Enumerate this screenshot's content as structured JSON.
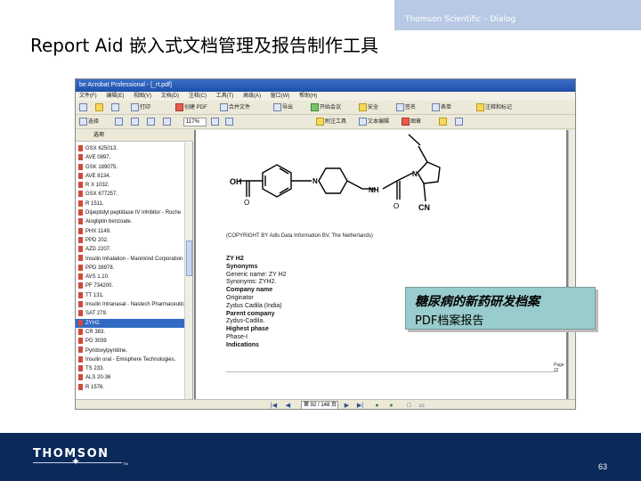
{
  "header": {
    "company": "Thomson Scientific – Dialog",
    "title": "Report Aid 嵌入式文档管理及报告制作工具"
  },
  "acrobat": {
    "window_title": "be Acrobat Professional - [_rt.pdf]",
    "menu": [
      "文件(F)",
      "编辑(E)",
      "视图(V)",
      "文档(D)",
      "注释(C)",
      "工具(T)",
      "高级(A)",
      "窗口(W)",
      "帮助(H)"
    ],
    "toolbar1": [
      "打印",
      "创建 PDF",
      "合并文件",
      "导出",
      "开始会议",
      "安全",
      "签名",
      "表单",
      "注释和标记"
    ],
    "toolbar2": [
      "选择",
      "117%",
      "附注工具",
      "文本编辑",
      "图章"
    ],
    "zoom": "117%",
    "bookmarks_panel_label": "选项",
    "bookmarks": [
      "GSX 625013.",
      "AVE 0897.",
      "GSK 189075.",
      "AVE 8134.",
      "R X 1032.",
      "GSX 677257.",
      "R 1511.",
      "Dipeptidyl peptidase IV Inhibitor - Roche",
      "Alogliptin benzoate.",
      "PHX 1149.",
      "PPD 202.",
      "AZD 2207.",
      "Insulin Inhalation - Mannkind Corporation",
      "PPD 38978.",
      "AVS 1.10.",
      "PF 734200.",
      "TT 131.",
      "Insulin Intranasal - Nastech Pharmaceutical",
      "SAT 279.",
      "ZYH2.",
      "CR 383.",
      "PG 3039",
      "Pyridoxylpyridine.",
      "Insulin oral - Emisphere Technologies.",
      "TS 233.",
      "ALS 20-36",
      "R 1576."
    ],
    "selected_bookmark_index": 19,
    "document": {
      "copyright": "(COPYRIGHT BY Adis Data Information BV, The Netherlands)",
      "info_lines": [
        {
          "text": "ZY H2",
          "bold": true
        },
        {
          "text": "Synonyms",
          "bold": true
        },
        {
          "text": "Generic name: ZY H2",
          "bold": false
        },
        {
          "text": "Synonyms: ZYH2.",
          "bold": false
        },
        {
          "text": "Company name",
          "bold": true
        },
        {
          "text": "Originator",
          "bold": false
        },
        {
          "text": "Zydus Cadila (India)",
          "bold": false
        },
        {
          "text": "Parent company",
          "bold": true
        },
        {
          "text": "Zydus-Cadila.",
          "bold": false
        },
        {
          "text": "Highest phase",
          "bold": true
        },
        {
          "text": "Phase-I",
          "bold": false
        },
        {
          "text": "Indications",
          "bold": true
        }
      ],
      "page_label": "Page 22",
      "chem_labels": {
        "oh": "OH",
        "o1": "O",
        "nh": "NH",
        "o2": "O",
        "cn": "CN",
        "n1": "N",
        "n2": "N"
      }
    },
    "page_indicator": "第 92 / 148 页"
  },
  "callout": {
    "title": "糖尿病的新药研发档案",
    "subtitle": "PDF档案报告"
  },
  "footer": {
    "logo": "THOMSON",
    "tm": "TM",
    "page_number": "63"
  },
  "colors": {
    "footer_bg": "#0b2a5a",
    "top_bar": "#b8c9e6",
    "callout_bg": "#99cccc",
    "selected_bookmark": "#316ac5"
  }
}
